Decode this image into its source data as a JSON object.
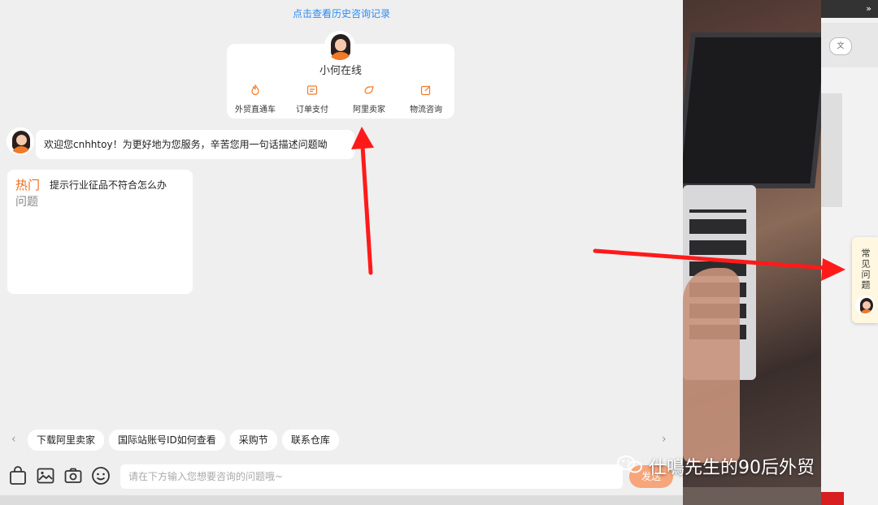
{
  "background": {
    "right_panel": {
      "top_right_symbol": "»",
      "chip_text": "文"
    },
    "faq_tab": {
      "label": "常见问题",
      "icon": "agent-avatar-icon"
    }
  },
  "chat": {
    "history_link": "点击查看历史咨询记录",
    "agent": {
      "name": "小何在线",
      "avatar_icon": "agent-avatar-icon",
      "quick_links": [
        {
          "icon": "fire-icon",
          "label": "外贸直通车"
        },
        {
          "icon": "order-icon",
          "label": "订单支付"
        },
        {
          "icon": "seller-icon",
          "label": "阿里卖家"
        },
        {
          "icon": "edit-icon",
          "label": "物流咨询"
        }
      ]
    },
    "welcome_message": "欢迎您cnhhtoy！为更好地为您服务，辛苦您用一句话描述问题呦",
    "hot_card": {
      "tag": "热门",
      "question": "提示行业征品不符合怎么办",
      "subtitle": "问题"
    },
    "suggestions": [
      "下载阿里卖家",
      "国际站账号ID如何查看",
      "采购节",
      "联系仓库"
    ],
    "toolbar": {
      "tools": [
        "bag-icon",
        "image-icon",
        "camera-icon",
        "emoji-icon"
      ],
      "input_placeholder": "请在下方输入您想要咨询的问题哦~",
      "send_label": "发送"
    }
  },
  "watermark": {
    "icon": "wechat-icon",
    "text": "仕鳴先生的90后外贸"
  },
  "colors": {
    "accent": "#f07a2a",
    "link": "#2d8cf0",
    "annotation_arrow": "#ff1a1a"
  }
}
